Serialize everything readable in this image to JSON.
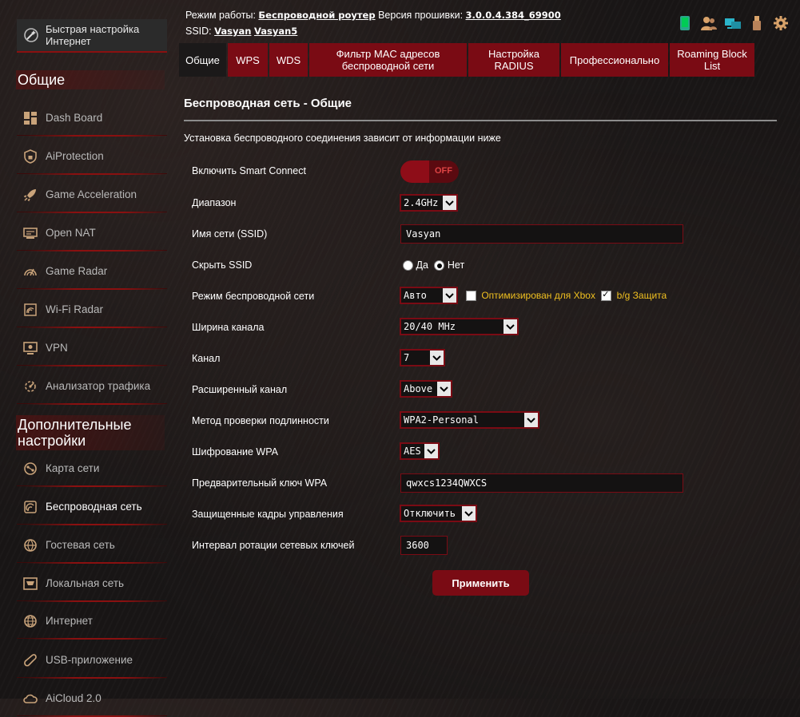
{
  "header": {
    "mode_label": "Режим работы:",
    "mode_value": "Беспроводной роутер",
    "firmware_label": "Версия прошивки:",
    "firmware_value": "3.0.0.4.384_69900",
    "ssid_label": "SSID:",
    "ssid_1": "Vasyan",
    "ssid_2": "Vasyan5"
  },
  "sidebar": {
    "quick_setup": "Быстрая настройка Интернет",
    "general_title": "Общие",
    "general_items": [
      {
        "label": "Dash Board",
        "icon": "dashboard-icon"
      },
      {
        "label": "AiProtection",
        "icon": "shield-icon"
      },
      {
        "label": "Game Acceleration",
        "icon": "rocket-icon"
      },
      {
        "label": "Open NAT",
        "icon": "open-nat-icon"
      },
      {
        "label": "Game Radar",
        "icon": "radar-icon"
      },
      {
        "label": "Wi-Fi Radar",
        "icon": "wifi-radar-icon"
      },
      {
        "label": "VPN",
        "icon": "vpn-icon"
      },
      {
        "label": "Анализатор трафика",
        "icon": "traffic-analyzer-icon"
      }
    ],
    "advanced_title": "Дополнительные настройки",
    "advanced_items": [
      {
        "label": "Карта сети",
        "icon": "network-map-icon"
      },
      {
        "label": "Беспроводная сеть",
        "icon": "wireless-icon"
      },
      {
        "label": "Гостевая сеть",
        "icon": "guest-network-icon"
      },
      {
        "label": "Локальная сеть",
        "icon": "lan-icon"
      },
      {
        "label": "Интернет",
        "icon": "globe-icon"
      },
      {
        "label": "USB-приложение",
        "icon": "usb-app-icon"
      },
      {
        "label": "AiCloud 2.0",
        "icon": "cloud-icon"
      }
    ]
  },
  "tabs": [
    {
      "label": "Общие"
    },
    {
      "label": "WPS"
    },
    {
      "label": "WDS"
    },
    {
      "label": "Фильтр MAC адресов беспроводной сети"
    },
    {
      "label": "Настройка RADIUS"
    },
    {
      "label": "Профессионально"
    },
    {
      "label": "Roaming Block List"
    }
  ],
  "main": {
    "title": "Беспроводная сеть - Общие",
    "description": "Установка беспроводного соединения зависит от информации ниже",
    "smart_connect_label": "Включить Smart Connect",
    "smart_connect_state": "OFF",
    "band_label": "Диапазон",
    "band_value": "2.4GHz",
    "ssid_label": "Имя сети (SSID)",
    "ssid_value": "Vasyan",
    "hide_ssid_label": "Скрыть SSID",
    "hide_yes": "Да",
    "hide_no": "Нет",
    "wireless_mode_label": "Режим беспроводной сети",
    "wireless_mode_value": "Авто",
    "xbox_label": "Оптимизирован для Xbox",
    "bg_protection_label": "b/g Защита",
    "channel_width_label": "Ширина канала",
    "channel_width_value": "20/40 MHz",
    "channel_label": "Канал",
    "channel_value": "7",
    "ext_channel_label": "Расширенный канал",
    "ext_channel_value": "Above",
    "auth_label": "Метод проверки подлинности",
    "auth_value": "WPA2-Personal",
    "wpa_enc_label": "Шифрование WPA",
    "wpa_enc_value": "AES",
    "psk_label": "Предварительный ключ WPA",
    "psk_value": "qwxcs1234QWXCS",
    "pmf_label": "Защищенные кадры управления",
    "pmf_value": "Отключить",
    "rekey_label": "Интервал ротации сетевых ключей",
    "rekey_value": "3600",
    "apply_label": "Применить"
  },
  "colors": {
    "accent": "#7a0b14",
    "highlight": "#f0c020"
  }
}
